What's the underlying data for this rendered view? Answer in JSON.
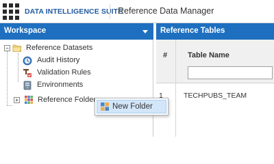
{
  "header": {
    "suite_name": "DATA INTELLIGENCE SUITE",
    "module_title": "Reference Data Manager",
    "accent": "#1e6fbf"
  },
  "workspace": {
    "title": "Workspace",
    "tree": {
      "root": {
        "label": "Reference Datasets",
        "state": "expanded",
        "icon": "folder-icon",
        "children": [
          {
            "label": "Audit History",
            "icon": "audit-history-icon"
          },
          {
            "label": "Validation Rules",
            "icon": "validation-rules-icon"
          },
          {
            "label": "Environments",
            "icon": "environments-icon"
          },
          {
            "label": "Reference Folders",
            "icon": "reference-folders-icon",
            "state": "collapsed"
          }
        ]
      }
    }
  },
  "context_menu": {
    "items": [
      {
        "label": "New Folder",
        "icon": "new-folder-icon",
        "highlighted": true
      }
    ]
  },
  "reference_tables": {
    "title": "Reference Tables",
    "columns": [
      "#",
      "Table Name"
    ],
    "filter": {
      "value": "",
      "placeholder": ""
    },
    "rows": [
      {
        "index": "1",
        "table_name": "TECHPUBS_TEAM"
      }
    ]
  }
}
